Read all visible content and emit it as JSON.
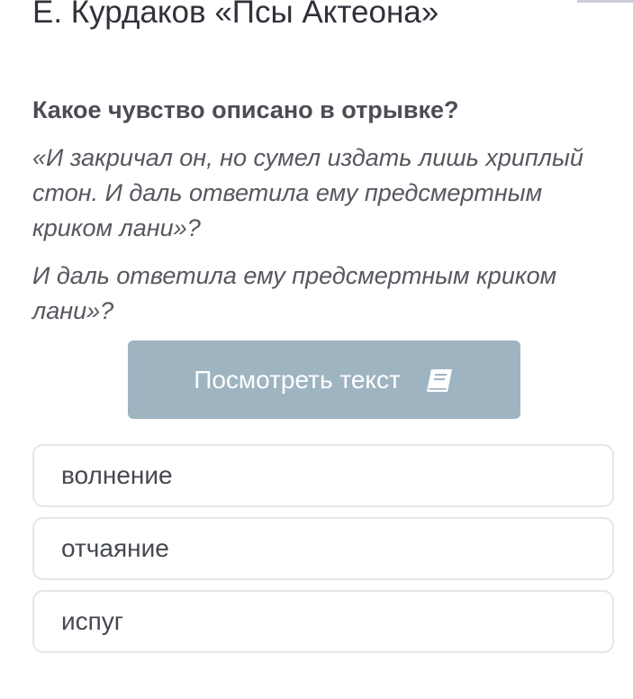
{
  "header": {
    "title": "Е. Курдаков «Псы Актеона»"
  },
  "question": {
    "text": "Какое чувство описано в отрывке?",
    "quote_1": "«И закричал он, но сумел издать лишь хриплый стон. И даль ответила ему предсмертным криком лани»?",
    "quote_2": "И даль ответила ему предсмертным криком лани»?"
  },
  "actions": {
    "view_text_label": "Посмотреть текст",
    "view_text_icon": "book-icon",
    "button_color": "#9fb4c1"
  },
  "answers": [
    {
      "label": "волнение"
    },
    {
      "label": "отчаяние"
    },
    {
      "label": "испуг"
    }
  ]
}
